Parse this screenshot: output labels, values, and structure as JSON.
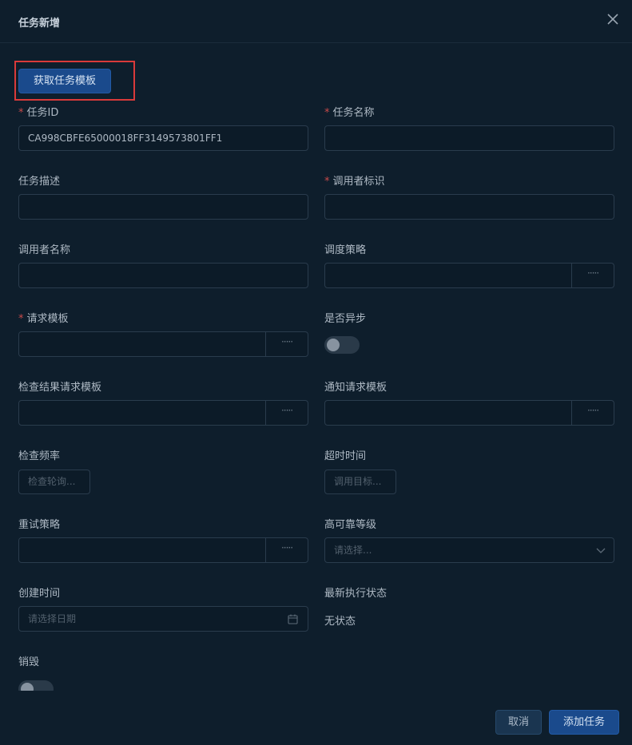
{
  "dialog": {
    "title": "任务新增",
    "get_template_label": "获取任务模板"
  },
  "fields": {
    "task_id": {
      "label": "任务ID",
      "value": "CA998CBFE65000018FF3149573801FF1"
    },
    "task_name": {
      "label": "任务名称",
      "value": ""
    },
    "task_desc": {
      "label": "任务描述",
      "value": ""
    },
    "caller_id": {
      "label": "调用者标识",
      "value": ""
    },
    "caller_name": {
      "label": "调用者名称",
      "value": ""
    },
    "schedule_policy": {
      "label": "调度策略",
      "value": "",
      "button": "·····"
    },
    "request_template": {
      "label": "请求模板",
      "value": "",
      "button": "·····"
    },
    "is_async": {
      "label": "是否异步",
      "on": false
    },
    "check_result_template": {
      "label": "检查结果请求模板",
      "value": "",
      "button": "·····"
    },
    "notify_template": {
      "label": "通知请求模板",
      "value": "",
      "button": "·····"
    },
    "check_freq": {
      "label": "检查频率",
      "placeholder": "检查轮询..."
    },
    "timeout": {
      "label": "超时时间",
      "placeholder": "调用目标..."
    },
    "retry_policy": {
      "label": "重试策略",
      "value": "",
      "button": "·····"
    },
    "ha_level": {
      "label": "高可靠等级",
      "placeholder": "请选择..."
    },
    "create_time": {
      "label": "创建时间",
      "placeholder": "请选择日期"
    },
    "latest_status": {
      "label": "最新执行状态",
      "value": "无状态"
    },
    "destroy": {
      "label": "销毁",
      "on": false
    }
  },
  "footer": {
    "cancel_label": "取消",
    "add_label": "添加任务"
  },
  "colors": {
    "background": "#0e1e2c",
    "primary": "#1a4a8c",
    "required": "#c94a4a",
    "highlight": "#d93a3a"
  }
}
